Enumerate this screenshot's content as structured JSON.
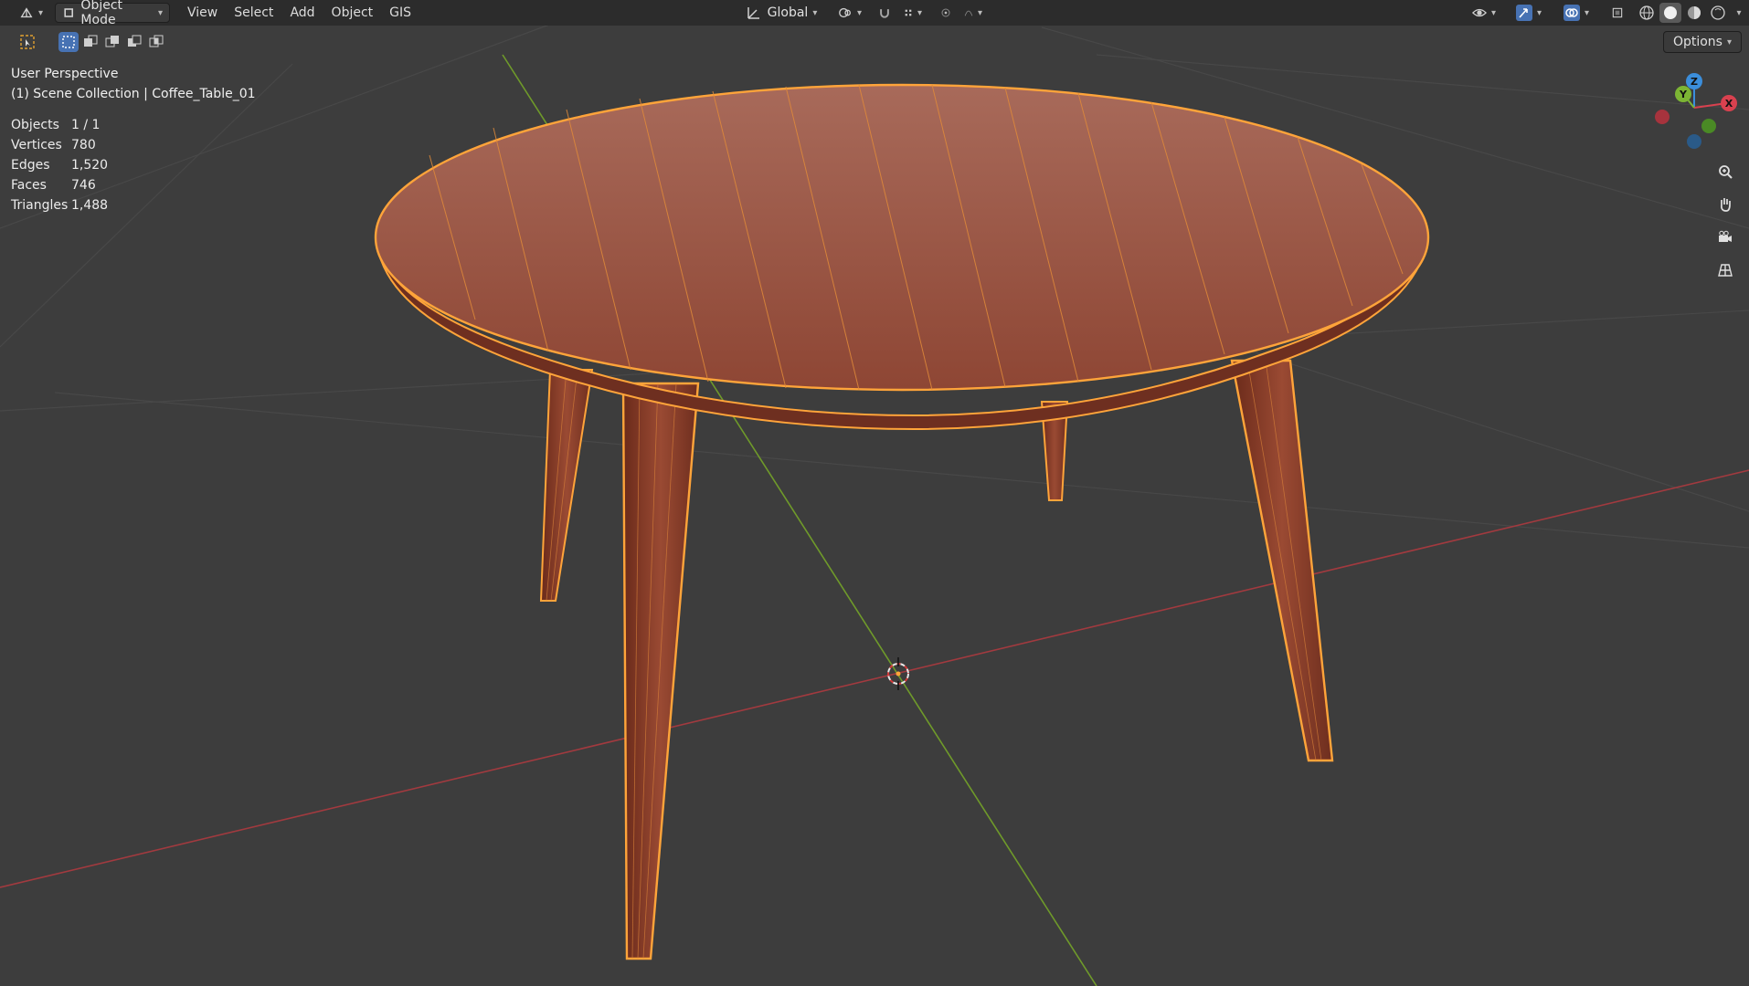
{
  "header": {
    "mode_label": "Object Mode",
    "menus": [
      "View",
      "Select",
      "Add",
      "Object",
      "GIS"
    ],
    "transform_orientation": "Global",
    "options_label": "Options"
  },
  "viewport": {
    "view_name": "User Perspective",
    "collection_path": "(1) Scene Collection | Coffee_Table_01"
  },
  "stats": {
    "objects_label": "Objects",
    "objects_value": "1 / 1",
    "vertices_label": "Vertices",
    "vertices_value": "780",
    "edges_label": "Edges",
    "edges_value": "1,520",
    "faces_label": "Faces",
    "faces_value": "746",
    "triangles_label": "Triangles",
    "triangles_value": "1,488"
  },
  "gizmo": {
    "z": "Z",
    "y": "Y",
    "x": "X"
  },
  "colors": {
    "background": "#3d3d3d",
    "grid": "#4a4a4a",
    "x_axis": "#a23a3f",
    "y_axis": "#6f9a2a",
    "selection_outline": "#ffa43a",
    "wood": "#a0503a"
  }
}
